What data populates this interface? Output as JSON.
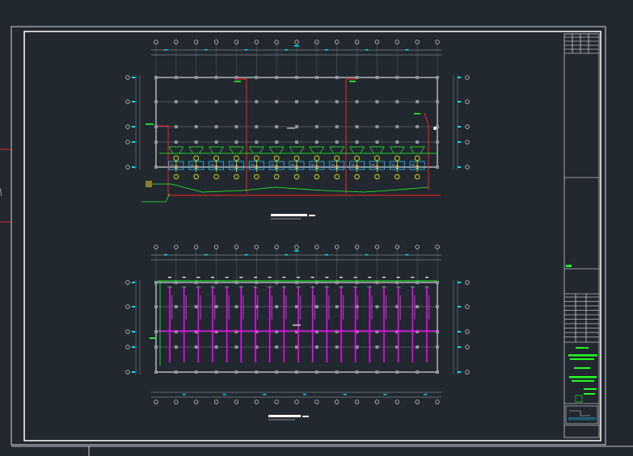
{
  "canvas": {
    "background": "#212830",
    "colors": {
      "frame": "#ffffff",
      "grid": "#a9adb2",
      "axis_tag": "#ffffff",
      "dimension": "#00e5ff",
      "pipe_red": "#ff2020",
      "pipe_green": "#22ff22",
      "pipe_yellow": "#ffff00",
      "pipe_magenta": "#ff00ff",
      "cyan_fixture": "#1ac6ff"
    }
  },
  "title_block": {
    "logo_label": "",
    "note_lines": 6
  },
  "plans": [
    {
      "id": "upper-plan",
      "caption": "",
      "column_count": 15,
      "row_count": 5,
      "fixture_count": 14
    },
    {
      "id": "lower-plan",
      "caption": "",
      "column_count": 15,
      "row_count": 5,
      "riser_count": 19
    }
  ]
}
